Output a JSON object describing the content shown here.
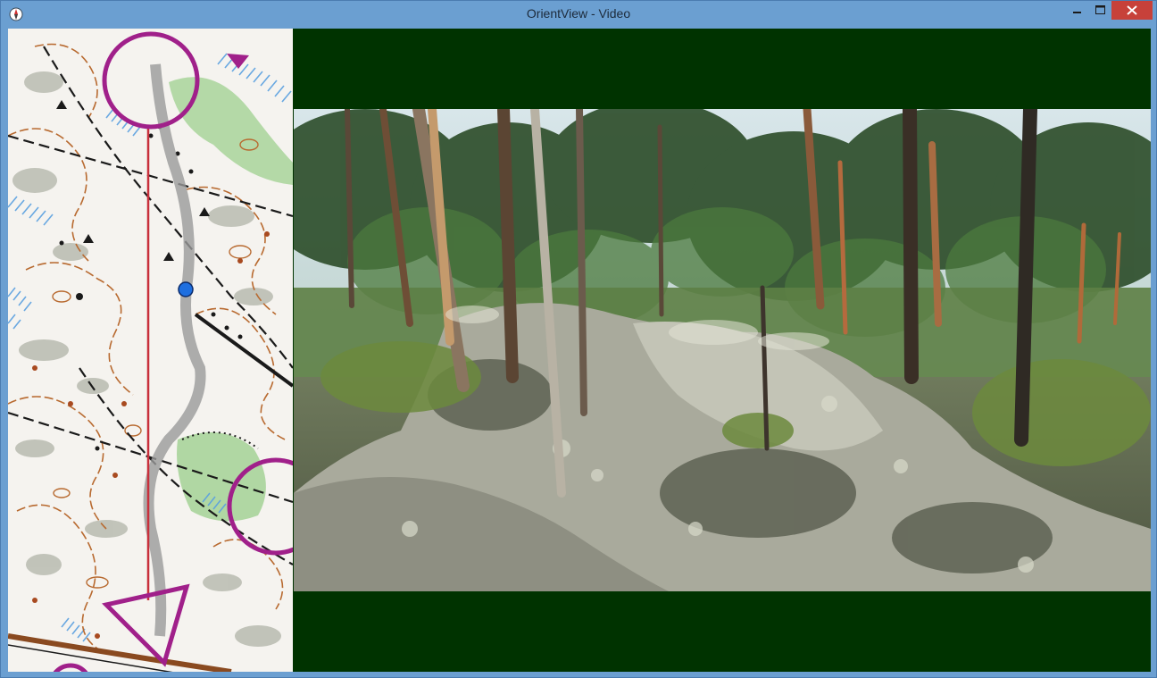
{
  "window": {
    "title": "OrientView - Video",
    "accent": "#6b9fd1",
    "close_color": "#c7413a",
    "letterbox_color": "#003300"
  },
  "title_controls": {
    "icons": [
      "minimize-icon",
      "maximize-icon",
      "close-icon"
    ]
  },
  "map": {
    "course_color": "#a0208a",
    "route_color": "#c8303c",
    "runner_color": "#1e6fe0",
    "icons": [
      "control-circle-icon",
      "start-triangle-icon",
      "runner-position-icon"
    ]
  },
  "video": {
    "scene": "forest-with-rock-outcrop"
  }
}
